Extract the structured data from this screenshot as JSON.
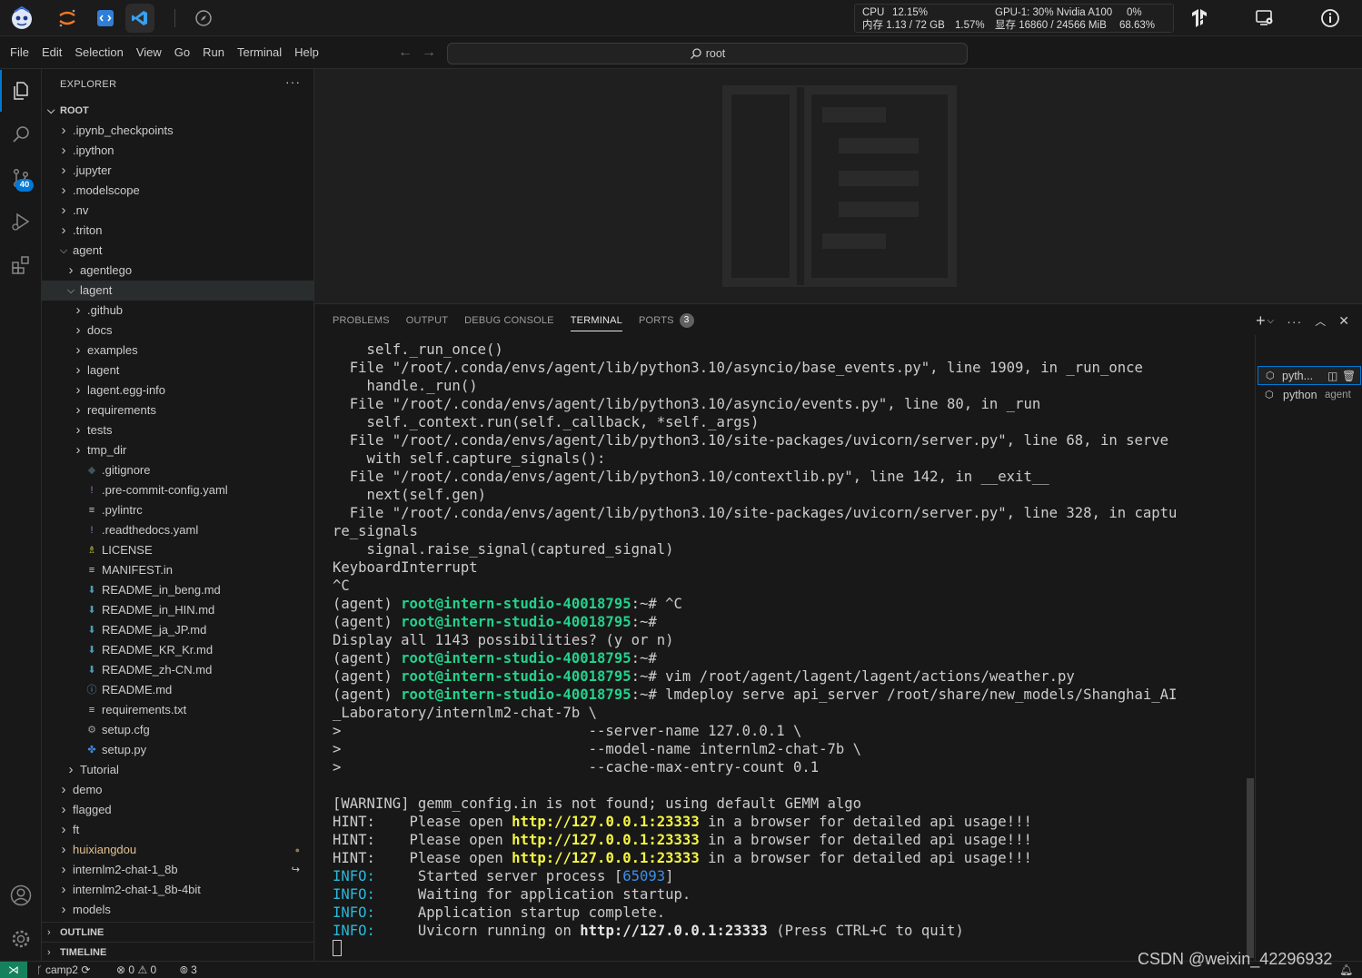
{
  "host_bar": {
    "cpu_label": "CPU",
    "cpu_value": "12.15%",
    "mem_label": "内存 1.13 / 72 GB",
    "mem_value": "1.57%",
    "gpu_label": "GPU-1: 30% Nvidia A100",
    "gpu_value": "0%",
    "vram_label": "显存 16860 / 24566 MiB",
    "vram_value": "68.63%"
  },
  "menu": [
    "File",
    "Edit",
    "Selection",
    "View",
    "Go",
    "Run",
    "Terminal",
    "Help"
  ],
  "command_center": {
    "text": "root"
  },
  "activity_bar": {
    "source_control_badge": "40"
  },
  "explorer": {
    "title": "EXPLORER",
    "root": "ROOT",
    "tree": [
      {
        "label": ".ipynb_checkpoints",
        "depth": 0,
        "type": "folder",
        "open": false
      },
      {
        "label": ".ipython",
        "depth": 0,
        "type": "folder",
        "open": false
      },
      {
        "label": ".jupyter",
        "depth": 0,
        "type": "folder",
        "open": false
      },
      {
        "label": ".modelscope",
        "depth": 0,
        "type": "folder",
        "open": false
      },
      {
        "label": ".nv",
        "depth": 0,
        "type": "folder",
        "open": false
      },
      {
        "label": ".triton",
        "depth": 0,
        "type": "folder",
        "open": false
      },
      {
        "label": "agent",
        "depth": 0,
        "type": "folder",
        "open": true
      },
      {
        "label": "agentlego",
        "depth": 1,
        "type": "folder",
        "open": false
      },
      {
        "label": "lagent",
        "depth": 1,
        "type": "folder",
        "open": true,
        "selected": true
      },
      {
        "label": ".github",
        "depth": 2,
        "type": "folder",
        "open": false
      },
      {
        "label": "docs",
        "depth": 2,
        "type": "folder",
        "open": false
      },
      {
        "label": "examples",
        "depth": 2,
        "type": "folder",
        "open": false
      },
      {
        "label": "lagent",
        "depth": 2,
        "type": "folder",
        "open": false
      },
      {
        "label": "lagent.egg-info",
        "depth": 2,
        "type": "folder",
        "open": false
      },
      {
        "label": "requirements",
        "depth": 2,
        "type": "folder",
        "open": false
      },
      {
        "label": "tests",
        "depth": 2,
        "type": "folder",
        "open": false
      },
      {
        "label": "tmp_dir",
        "depth": 2,
        "type": "folder",
        "open": false
      },
      {
        "label": ".gitignore",
        "depth": 2,
        "type": "file",
        "icon": "git-icon"
      },
      {
        "label": ".pre-commit-config.yaml",
        "depth": 2,
        "type": "file",
        "icon": "yaml-icon"
      },
      {
        "label": ".pylintrc",
        "depth": 2,
        "type": "file",
        "icon": "lines-icon"
      },
      {
        "label": ".readthedocs.yaml",
        "depth": 2,
        "type": "file",
        "icon": "yaml-icon"
      },
      {
        "label": "LICENSE",
        "depth": 2,
        "type": "file",
        "icon": "license-icon"
      },
      {
        "label": "MANIFEST.in",
        "depth": 2,
        "type": "file",
        "icon": "lines-icon"
      },
      {
        "label": "README_in_beng.md",
        "depth": 2,
        "type": "file",
        "icon": "markdown-icon"
      },
      {
        "label": "README_in_HIN.md",
        "depth": 2,
        "type": "file",
        "icon": "markdown-icon"
      },
      {
        "label": "README_ja_JP.md",
        "depth": 2,
        "type": "file",
        "icon": "markdown-icon"
      },
      {
        "label": "README_KR_Kr.md",
        "depth": 2,
        "type": "file",
        "icon": "markdown-icon"
      },
      {
        "label": "README_zh-CN.md",
        "depth": 2,
        "type": "file",
        "icon": "markdown-icon"
      },
      {
        "label": "README.md",
        "depth": 2,
        "type": "file",
        "icon": "info-icon"
      },
      {
        "label": "requirements.txt",
        "depth": 2,
        "type": "file",
        "icon": "lines-icon"
      },
      {
        "label": "setup.cfg",
        "depth": 2,
        "type": "file",
        "icon": "gear-icon"
      },
      {
        "label": "setup.py",
        "depth": 2,
        "type": "file",
        "icon": "python-icon"
      },
      {
        "label": "Tutorial",
        "depth": 1,
        "type": "folder",
        "open": false
      },
      {
        "label": "demo",
        "depth": 0,
        "type": "folder",
        "open": false
      },
      {
        "label": "flagged",
        "depth": 0,
        "type": "folder",
        "open": false
      },
      {
        "label": "ft",
        "depth": 0,
        "type": "folder",
        "open": false
      },
      {
        "label": "huixiangdou",
        "depth": 0,
        "type": "folder",
        "open": false,
        "modified": true
      },
      {
        "label": "internlm2-chat-1_8b",
        "depth": 0,
        "type": "folder",
        "open": false,
        "symlink": true
      },
      {
        "label": "internlm2-chat-1_8b-4bit",
        "depth": 0,
        "type": "folder",
        "open": false
      },
      {
        "label": "models",
        "depth": 0,
        "type": "folder",
        "open": false
      }
    ],
    "outline": "OUTLINE",
    "timeline": "TIMELINE"
  },
  "panel": {
    "tabs": [
      "PROBLEMS",
      "OUTPUT",
      "DEBUG CONSOLE",
      "TERMINAL",
      "PORTS"
    ],
    "active_tab": "TERMINAL",
    "ports_count": "3"
  },
  "terminal": {
    "prompt_env": "(agent) ",
    "prompt_host": "root@intern-studio-40018795",
    "prompt_path": ":~# ",
    "lines": [
      "    self._run_once()",
      "  File \"/root/.conda/envs/agent/lib/python3.10/asyncio/base_events.py\", line 1909, in _run_once",
      "    handle._run()",
      "  File \"/root/.conda/envs/agent/lib/python3.10/asyncio/events.py\", line 80, in _run",
      "    self._context.run(self._callback, *self._args)",
      "  File \"/root/.conda/envs/agent/lib/python3.10/site-packages/uvicorn/server.py\", line 68, in serve",
      "    with self.capture_signals():",
      "  File \"/root/.conda/envs/agent/lib/python3.10/contextlib.py\", line 142, in __exit__",
      "    next(self.gen)",
      "  File \"/root/.conda/envs/agent/lib/python3.10/site-packages/uvicorn/server.py\", line 328, in captu",
      "re_signals",
      "    signal.raise_signal(captured_signal)",
      "KeyboardInterrupt",
      "^C"
    ],
    "prompts": [
      {
        "cmd": "^C",
        "marker": ""
      },
      {
        "cmd": "",
        "marker": ""
      },
      {
        "cmd": "",
        "marker": ""
      },
      {
        "cmd": "vim /root/agent/lagent/lagent/actions/weather.py",
        "marker": "filled"
      },
      {
        "cmd": "lmdeploy serve api_server /root/share/new_models/Shanghai_AI",
        "marker": "hollow"
      }
    ],
    "display_line": "Display all 1143 possibilities? (y or n)",
    "continuation": "_Laboratory/internlm2-chat-7b \\",
    "args": [
      ">                             --server-name 127.0.0.1 \\",
      ">                             --model-name internlm2-chat-7b \\",
      ">                             --cache-max-entry-count 0.1"
    ],
    "warning": "[WARNING] gemm_config.in is not found; using default GEMM algo",
    "hint_label": "HINT:",
    "hint_pre": "    Please open ",
    "hint_url": "http://127.0.0.1:23333",
    "hint_post": " in a browser for detailed api usage!!!",
    "info_label": "INFO:",
    "info_lines": [
      {
        "text": "     Started server process [",
        "num": "65093",
        "tail": "]"
      },
      {
        "text": "     Waiting for application startup.",
        "num": "",
        "tail": ""
      },
      {
        "text": "     Application startup complete.",
        "num": "",
        "tail": ""
      }
    ],
    "uvicorn_pre": "     Uvicorn running on ",
    "uvicorn_url": "http://127.0.0.1:23333",
    "uvicorn_post": " (Press CTRL+C to quit)"
  },
  "terminal_list": [
    {
      "label": "pyth...",
      "active": true
    },
    {
      "label": "python",
      "sub": "agent",
      "active": false
    }
  ],
  "status_bar": {
    "branch": "camp2",
    "errors": "0",
    "warnings": "0",
    "ports": "3"
  },
  "watermark": "CSDN @weixin_42296932",
  "colors": {
    "accent": "#0078d4",
    "prompt_green": "#23d18b",
    "url_yellow": "#f5f543",
    "info_cyan": "#29b8db",
    "remote_green": "#16825d",
    "modified_yellow": "#e2c08d"
  }
}
